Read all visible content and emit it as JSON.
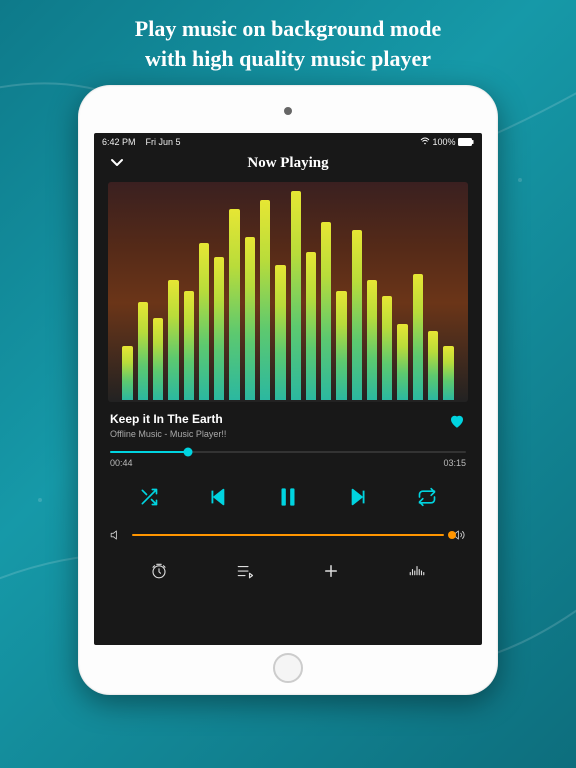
{
  "headline_line1": "Play music on background mode",
  "headline_line2": "with high quality music player",
  "status": {
    "time": "6:42 PM",
    "date": "Fri Jun 5",
    "battery": "100%"
  },
  "nav": {
    "title": "Now Playing"
  },
  "track": {
    "title": "Keep it In The Earth",
    "artist": "Offline Music - Music Player!!",
    "elapsed": "00:44",
    "duration": "03:15",
    "progress_pct": 22
  },
  "volume": {
    "pct": 100
  },
  "eq_heights_pct": [
    25,
    45,
    38,
    55,
    50,
    72,
    66,
    88,
    75,
    92,
    62,
    96,
    68,
    82,
    50,
    78,
    55,
    48,
    35,
    58,
    32,
    25
  ],
  "colors": {
    "accent": "#00d4e0",
    "volume": "#ff9500"
  }
}
